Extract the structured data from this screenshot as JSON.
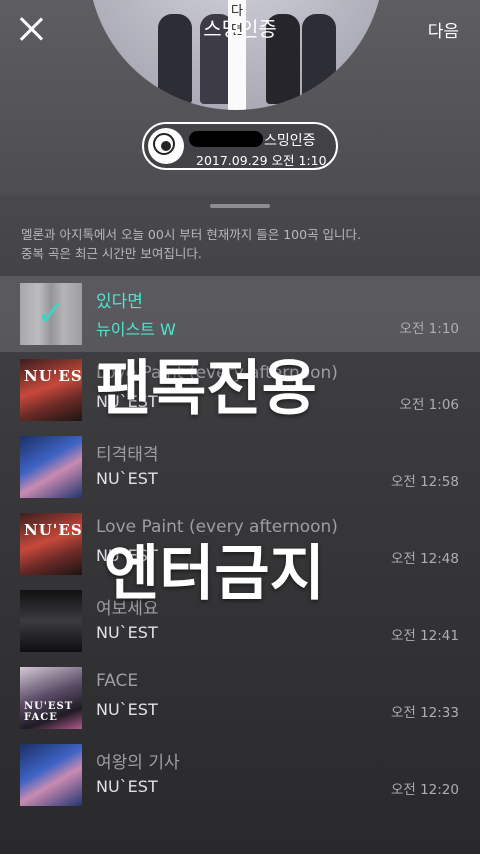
{
  "header": {
    "title": "스밍인증",
    "next_label": "다음",
    "disc_text": [
      "다",
      "면"
    ]
  },
  "badge": {
    "label": "스밍인증",
    "datetime": "2017.09.29 오전 1:10"
  },
  "info_lines": [
    "멜론과 아지톡에서 오늘 00시 부터 현재까지 들은 100곡 입니다.",
    "중복 곡은 최근 시간만 보여집니다."
  ],
  "songs": [
    {
      "title": "있다면",
      "artist": "뉴이스트 W",
      "time": "오전 1:10",
      "selected": true,
      "art_label": ""
    },
    {
      "title": "Love Paint (every afternoon)",
      "artist": "NU`EST",
      "time": "오전 1:06",
      "selected": false,
      "art_label": "NU'EST"
    },
    {
      "title": "티격태격",
      "artist": "NU`EST",
      "time": "오전 12:58",
      "selected": false,
      "art_label": ""
    },
    {
      "title": "Love Paint (every afternoon)",
      "artist": "NU`EST",
      "time": "오전 12:48",
      "selected": false,
      "art_label": "NU'EST"
    },
    {
      "title": "여보세요",
      "artist": "NU`EST",
      "time": "오전 12:41",
      "selected": false,
      "art_label": ""
    },
    {
      "title": "FACE",
      "artist": "NU`EST",
      "time": "오전 12:33",
      "selected": false,
      "art_label": "NU'EST FACE"
    },
    {
      "title": "여왕의 기사",
      "artist": "NU`EST",
      "time": "오전 12:20",
      "selected": false,
      "art_label": ""
    }
  ],
  "watermark": {
    "line1": "팬톡전용",
    "line2": "엔터금지"
  },
  "colors": {
    "accent": "#4ee3d0",
    "check": "#3fd3c4"
  }
}
